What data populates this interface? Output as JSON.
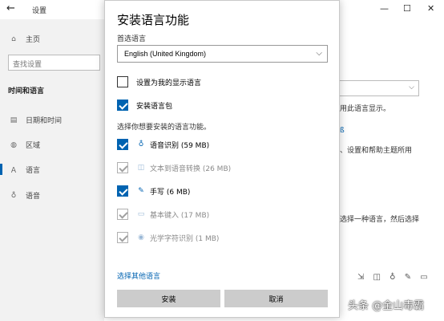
{
  "window": {
    "title": "设置",
    "back_glyph": "←",
    "minimize_glyph": "—",
    "maximize_glyph": "☐",
    "close_glyph": "✕"
  },
  "sidebar": {
    "home": "主页",
    "search_placeholder": "查找设置",
    "heading": "时间和语言",
    "items": [
      {
        "label": "日期和时间",
        "icon": "calendar-icon"
      },
      {
        "label": "区域",
        "icon": "globe-icon"
      },
      {
        "label": "语言",
        "icon": "language-icon"
      },
      {
        "label": "语音",
        "icon": "microphone-icon"
      }
    ]
  },
  "background_right": {
    "text1": "用此语言显示。",
    "text2": "、设置和帮助主题所用",
    "text3": "选择一种语言，然后选择"
  },
  "dialog": {
    "title": "安装语言功能",
    "preferred_label": "首选语言",
    "selected_language": "English (United Kingdom)",
    "options": [
      {
        "label": "设置为我的显示语言",
        "checked": false
      },
      {
        "label": "安装语言包",
        "checked": true
      }
    ],
    "features_label": "选择你想要安装的语言功能。",
    "features": [
      {
        "label": "语音识别 (59 MB)",
        "state": "checked",
        "icon": "microphone-icon"
      },
      {
        "label": "文本到语音转换 (26 MB)",
        "state": "disabled",
        "icon": "speech-bubble-icon"
      },
      {
        "label": "手写 (6 MB)",
        "state": "checked",
        "icon": "handwriting-icon"
      },
      {
        "label": "基本键入 (17 MB)",
        "state": "disabled",
        "icon": "keyboard-icon"
      },
      {
        "label": "光学字符识别 (1 MB)",
        "state": "disabled",
        "icon": "ocr-icon"
      }
    ],
    "other_languages_link": "选择其他语言",
    "install_button": "安装",
    "cancel_button": "取消"
  },
  "watermark": "头条 @金山毒霸",
  "colors": {
    "accent": "#0063b1",
    "button_bg": "#cccccc",
    "sidebar_bg": "#f2f2f2"
  }
}
